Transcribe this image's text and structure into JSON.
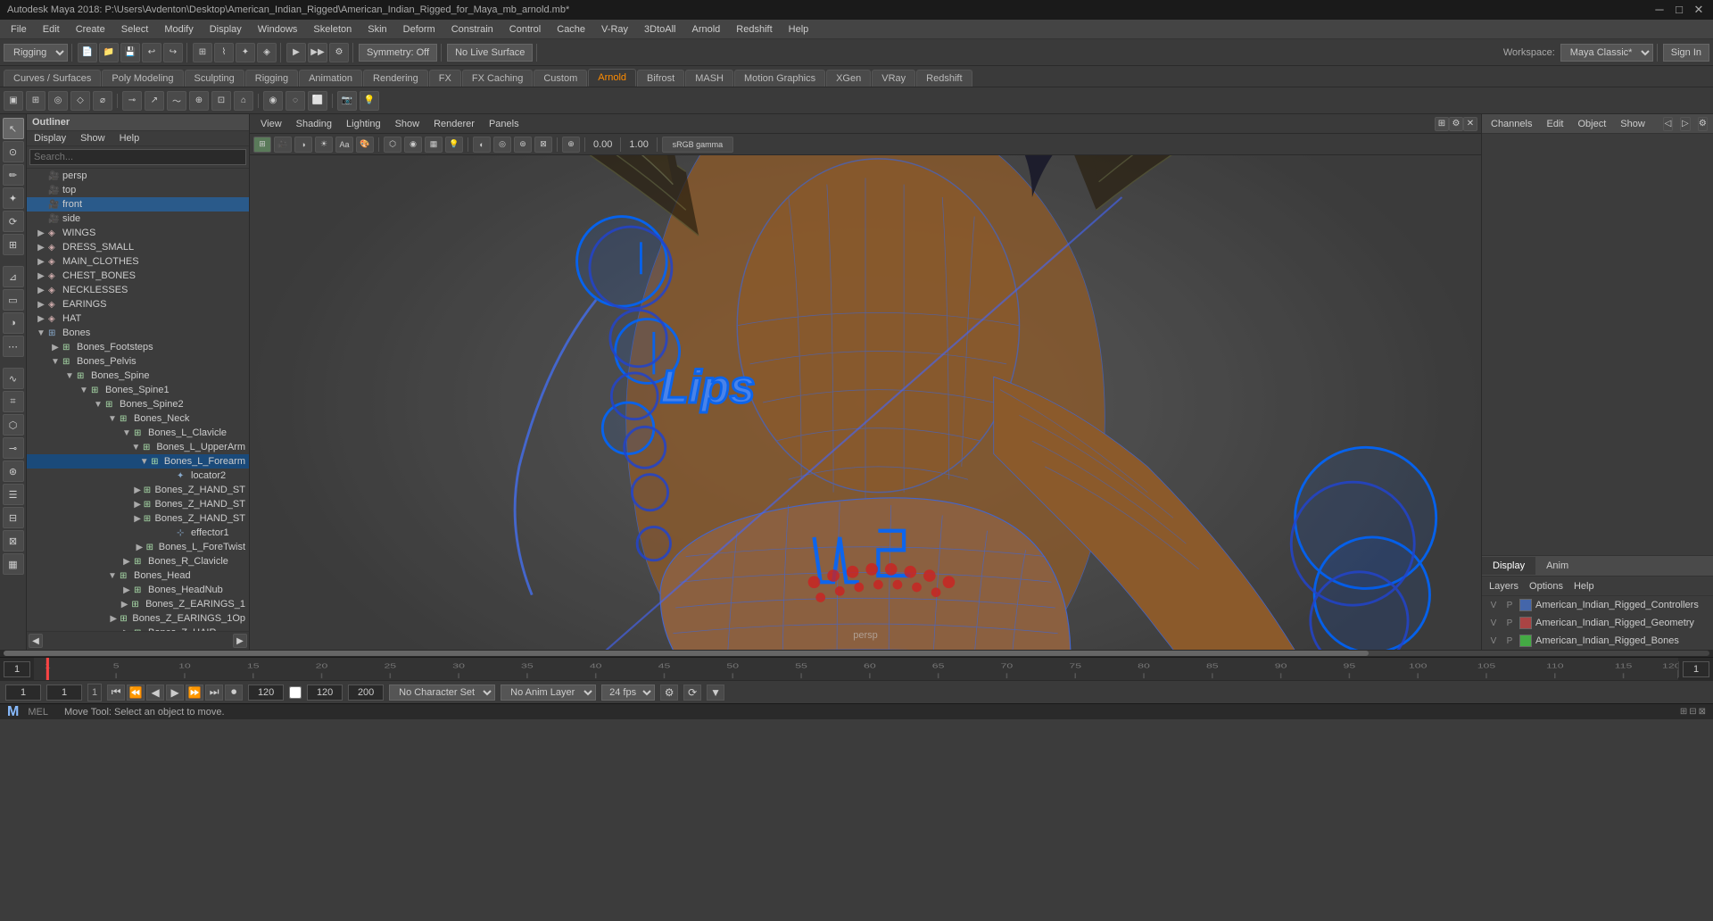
{
  "titlebar": {
    "title": "Autodesk Maya 2018: P:\\Users\\Avdenton\\Desktop\\American_Indian_Rigged\\American_Indian_Rigged_for_Maya_mb_arnold.mb*",
    "min": "─",
    "max": "□",
    "close": "✕"
  },
  "menubar": {
    "items": [
      "File",
      "Edit",
      "Create",
      "Select",
      "Modify",
      "Display",
      "Windows",
      "Skeleton",
      "Skin",
      "Deform",
      "Constrain",
      "Control",
      "Cache",
      "V-Ray",
      "3DtoAll",
      "Arnold",
      "Redshift",
      "Help"
    ]
  },
  "workspace": {
    "current": "Rigging",
    "label": "Workspace:",
    "name": "Maya Classic*"
  },
  "symmetry": {
    "label": "Symmetry: Off"
  },
  "no_live_surface": {
    "label": "No Live Surface"
  },
  "sign_in": {
    "label": "Sign In"
  },
  "tabs": {
    "items": [
      "Curves / Surfaces",
      "Poly Modeling",
      "Sculpting",
      "Rigging",
      "Animation",
      "Rendering",
      "FX",
      "FX Caching",
      "Custom",
      "Arnold",
      "Bifrost",
      "MASH",
      "Motion Graphics",
      "XGen",
      "VRay",
      "Redshift"
    ]
  },
  "outliner": {
    "title": "Outliner",
    "menus": [
      "Display",
      "Show",
      "Help"
    ],
    "search_placeholder": "Search...",
    "items": [
      {
        "indent": 0,
        "icon": "cam",
        "label": "persp",
        "arrow": "",
        "expanded": false
      },
      {
        "indent": 0,
        "icon": "cam",
        "label": "top",
        "arrow": "",
        "expanded": false
      },
      {
        "indent": 0,
        "icon": "cam",
        "label": "front",
        "arrow": "",
        "expanded": false,
        "selected": true
      },
      {
        "indent": 0,
        "icon": "cam",
        "label": "side",
        "arrow": "",
        "expanded": false
      },
      {
        "indent": 0,
        "icon": "shape",
        "label": "WINGS",
        "arrow": "▶",
        "expanded": false
      },
      {
        "indent": 0,
        "icon": "shape",
        "label": "DRESS_SMALL",
        "arrow": "▶",
        "expanded": false
      },
      {
        "indent": 0,
        "icon": "shape",
        "label": "MAIN_CLOTHES",
        "arrow": "▶",
        "expanded": false
      },
      {
        "indent": 0,
        "icon": "shape",
        "label": "CHEST_BONES",
        "arrow": "▶",
        "expanded": false
      },
      {
        "indent": 0,
        "icon": "shape",
        "label": "NECKLESSES",
        "arrow": "▶",
        "expanded": false
      },
      {
        "indent": 0,
        "icon": "shape",
        "label": "EARINGS",
        "arrow": "▶",
        "expanded": false
      },
      {
        "indent": 0,
        "icon": "shape",
        "label": "HAT",
        "arrow": "▶",
        "expanded": false
      },
      {
        "indent": 0,
        "icon": "group",
        "label": "Bones",
        "arrow": "▼",
        "expanded": true
      },
      {
        "indent": 1,
        "icon": "group",
        "label": "Bones_Footsteps",
        "arrow": "▶",
        "expanded": false
      },
      {
        "indent": 1,
        "icon": "group",
        "label": "Bones_Pelvis",
        "arrow": "▼",
        "expanded": true
      },
      {
        "indent": 2,
        "icon": "group",
        "label": "Bones_Spine",
        "arrow": "▼",
        "expanded": true
      },
      {
        "indent": 3,
        "icon": "group",
        "label": "Bones_Spine1",
        "arrow": "▼",
        "expanded": true
      },
      {
        "indent": 4,
        "icon": "group",
        "label": "Bones_Spine2",
        "arrow": "▼",
        "expanded": true
      },
      {
        "indent": 5,
        "icon": "group",
        "label": "Bones_Neck",
        "arrow": "▼",
        "expanded": true
      },
      {
        "indent": 6,
        "icon": "group",
        "label": "Bones_L_Clavicle",
        "arrow": "▼",
        "expanded": true
      },
      {
        "indent": 7,
        "icon": "group",
        "label": "Bones_L_UpperArm",
        "arrow": "▼",
        "expanded": true
      },
      {
        "indent": 8,
        "icon": "group",
        "label": "Bones_L_Forearm",
        "arrow": "▼",
        "expanded": true,
        "selected": true,
        "highlighted": true
      },
      {
        "indent": 9,
        "icon": "locator",
        "label": "locator2",
        "arrow": "",
        "expanded": false
      },
      {
        "indent": 9,
        "icon": "group",
        "label": "Bones_Z_HAND_ST",
        "arrow": "▶",
        "expanded": false
      },
      {
        "indent": 9,
        "icon": "group",
        "label": "Bones_Z_HAND_ST",
        "arrow": "▶",
        "expanded": false
      },
      {
        "indent": 9,
        "icon": "group",
        "label": "Bones_Z_HAND_ST",
        "arrow": "▶",
        "expanded": false
      },
      {
        "indent": 9,
        "icon": "effector",
        "label": "effector1",
        "arrow": "",
        "expanded": false
      },
      {
        "indent": 8,
        "icon": "group",
        "label": "Bones_L_ForeTwist",
        "arrow": "▶",
        "expanded": false
      },
      {
        "indent": 6,
        "icon": "group",
        "label": "Bones_R_Clavicle",
        "arrow": "▶",
        "expanded": false
      },
      {
        "indent": 5,
        "icon": "group",
        "label": "Bones_Head",
        "arrow": "▼",
        "expanded": true
      },
      {
        "indent": 6,
        "icon": "group",
        "label": "Bones_HeadNub",
        "arrow": "▶",
        "expanded": false
      },
      {
        "indent": 6,
        "icon": "group",
        "label": "Bones_Z_EARINGS_1",
        "arrow": "▶",
        "expanded": false
      },
      {
        "indent": 6,
        "icon": "group",
        "label": "Bones_Z_EARINGS_1Op",
        "arrow": "▶",
        "expanded": false
      },
      {
        "indent": 6,
        "icon": "group",
        "label": "Bones_Z_HAIR",
        "arrow": "▶",
        "expanded": false
      }
    ]
  },
  "viewport": {
    "menus": [
      "View",
      "Shading",
      "Lighting",
      "Show",
      "Renderer",
      "Panels"
    ],
    "value1": "0.00",
    "value2": "1.00",
    "gamma": "sRGB gamma",
    "label": "persp"
  },
  "channel_box": {
    "menus": [
      "Channels",
      "Edit",
      "Object",
      "Show"
    ],
    "display_tab": "Display",
    "anim_tab": "Anim",
    "sub_menus": [
      "Layers",
      "Options",
      "Help"
    ],
    "layers": [
      {
        "v": "V",
        "p": "P",
        "color": "blue",
        "name": "American_Indian_Rigged_Controllers"
      },
      {
        "v": "V",
        "p": "P",
        "color": "red",
        "name": "American_Indian_Rigged_Geometry"
      },
      {
        "v": "V",
        "p": "P",
        "color": "green",
        "name": "American_Indian_Rigged_Bones"
      }
    ]
  },
  "timeline": {
    "start": 1,
    "end": 120,
    "current": 1,
    "ticks": [
      1,
      5,
      10,
      15,
      20,
      25,
      30,
      35,
      40,
      45,
      50,
      55,
      60,
      65,
      70,
      75,
      80,
      85,
      90,
      95,
      100,
      105,
      110,
      115,
      120
    ]
  },
  "bottom_controls": {
    "frame_start": "1",
    "frame_current": "1",
    "frame_indicator": "1",
    "playback_end": "120",
    "total_frames": "200",
    "no_character": "No Character Set",
    "no_anim_layer": "No Anim Layer",
    "fps": "24 fps",
    "play_btns": [
      "⏮",
      "⏪",
      "◀",
      "▶",
      "⏩",
      "⏭",
      "⏺"
    ]
  },
  "statusbar": {
    "mel_label": "MEL",
    "status_msg": "Move Tool: Select an object to move."
  },
  "left_tools": [
    "▲",
    "✦",
    "↔",
    "⟳",
    "⊡",
    "⬡",
    "⟦⟧",
    "▯",
    "◇",
    "☰",
    "⊞",
    "⊟",
    "⊠",
    "▦"
  ]
}
